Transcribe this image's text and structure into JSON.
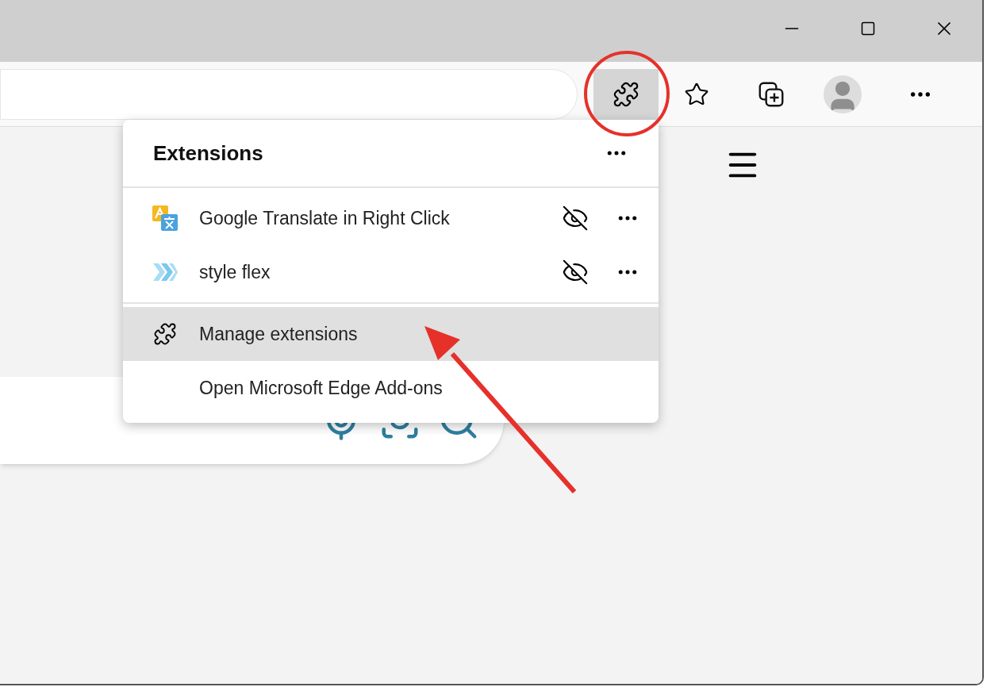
{
  "extensions_menu": {
    "title": "Extensions",
    "extensions": [
      {
        "name": "Google Translate in Right Click",
        "kind": "translate"
      },
      {
        "name": "style flex",
        "kind": "chevrons"
      }
    ],
    "actions": [
      {
        "label": "Manage extensions",
        "highlighted": true,
        "kind": "puzzle"
      },
      {
        "label": "Open Microsoft Edge Add-ons",
        "highlighted": false,
        "kind": "plain"
      }
    ]
  },
  "toolbar": {
    "extensions_button": {
      "selected": true
    }
  }
}
